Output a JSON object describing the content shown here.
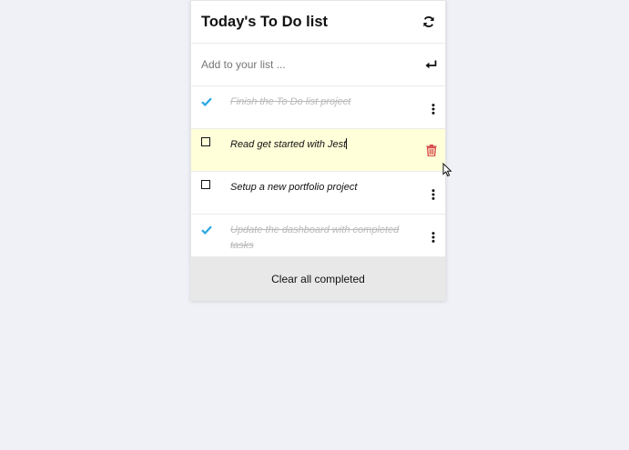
{
  "header": {
    "title": "Today's To Do list",
    "refresh_icon": "refresh-icon"
  },
  "add": {
    "placeholder": "Add to your list ...",
    "enter_icon": "enter-icon"
  },
  "tasks": [
    {
      "text": "Finish the To Do list project",
      "completed": true
    },
    {
      "text": "Read get started with Jest",
      "completed": false,
      "editing": true
    },
    {
      "text": "Setup a new portfolio project",
      "completed": false
    },
    {
      "text": "Update the dashboard with completed tasks",
      "completed": true
    }
  ],
  "footer": {
    "clear_label": "Clear all completed"
  },
  "colors": {
    "check": "#2aa6e0",
    "trash": "#d94a4a",
    "hover_row": "#ffffd9",
    "footer_bg": "#e8e8e8",
    "page_bg": "#eff1f6"
  }
}
